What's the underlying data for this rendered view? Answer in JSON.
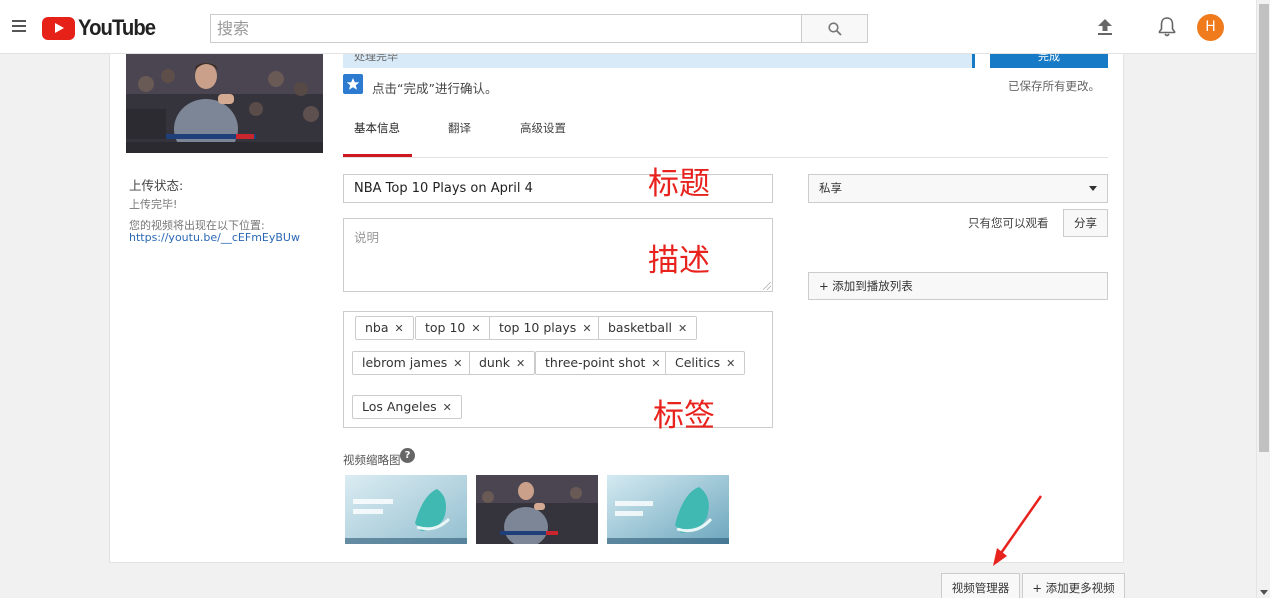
{
  "header": {
    "logo_text": "YouTube",
    "search_placeholder": "搜索",
    "avatar_letter": "H"
  },
  "left": {
    "upload_status_label": "上传状态:",
    "upload_complete": "上传完毕!",
    "location_text": "您的视频将出现在以下位置:",
    "video_url": "https://youtu.be/__cEFmEyBUw"
  },
  "banner": {
    "processing_text": "处理完毕",
    "done_button": "完成",
    "confirm_text": "点击“完成”进行确认。",
    "saved_text": "已保存所有更改。"
  },
  "tabs": [
    {
      "label": "基本信息",
      "active": true
    },
    {
      "label": "翻译",
      "active": false
    },
    {
      "label": "高级设置",
      "active": false
    }
  ],
  "form": {
    "title_value": "NBA Top 10 Plays on April 4",
    "description_placeholder": "说明",
    "tags": [
      "nba",
      "top 10",
      "top 10 plays",
      "basketball",
      "lebrom james",
      "dunk",
      "three-point shot",
      "Celitics",
      "Los Angeles"
    ],
    "thumbnails_label": "视频缩略图",
    "help_glyph": "?"
  },
  "annotations": {
    "title_note": "标题",
    "description_note": "描述",
    "tags_note": "标签"
  },
  "sidebar": {
    "privacy_value": "私享",
    "only_you_text": "只有您可以观看",
    "share_button": "分享",
    "add_playlist_button": "+ 添加到播放列表"
  },
  "footer": {
    "video_manager_button": "视频管理器",
    "add_more_button": "+ 添加更多视频"
  },
  "colors": {
    "brand_red": "#e62117",
    "primary_blue": "#167ac6",
    "annotation_red": "#e8231e",
    "avatar_orange": "#ef7b1d"
  }
}
